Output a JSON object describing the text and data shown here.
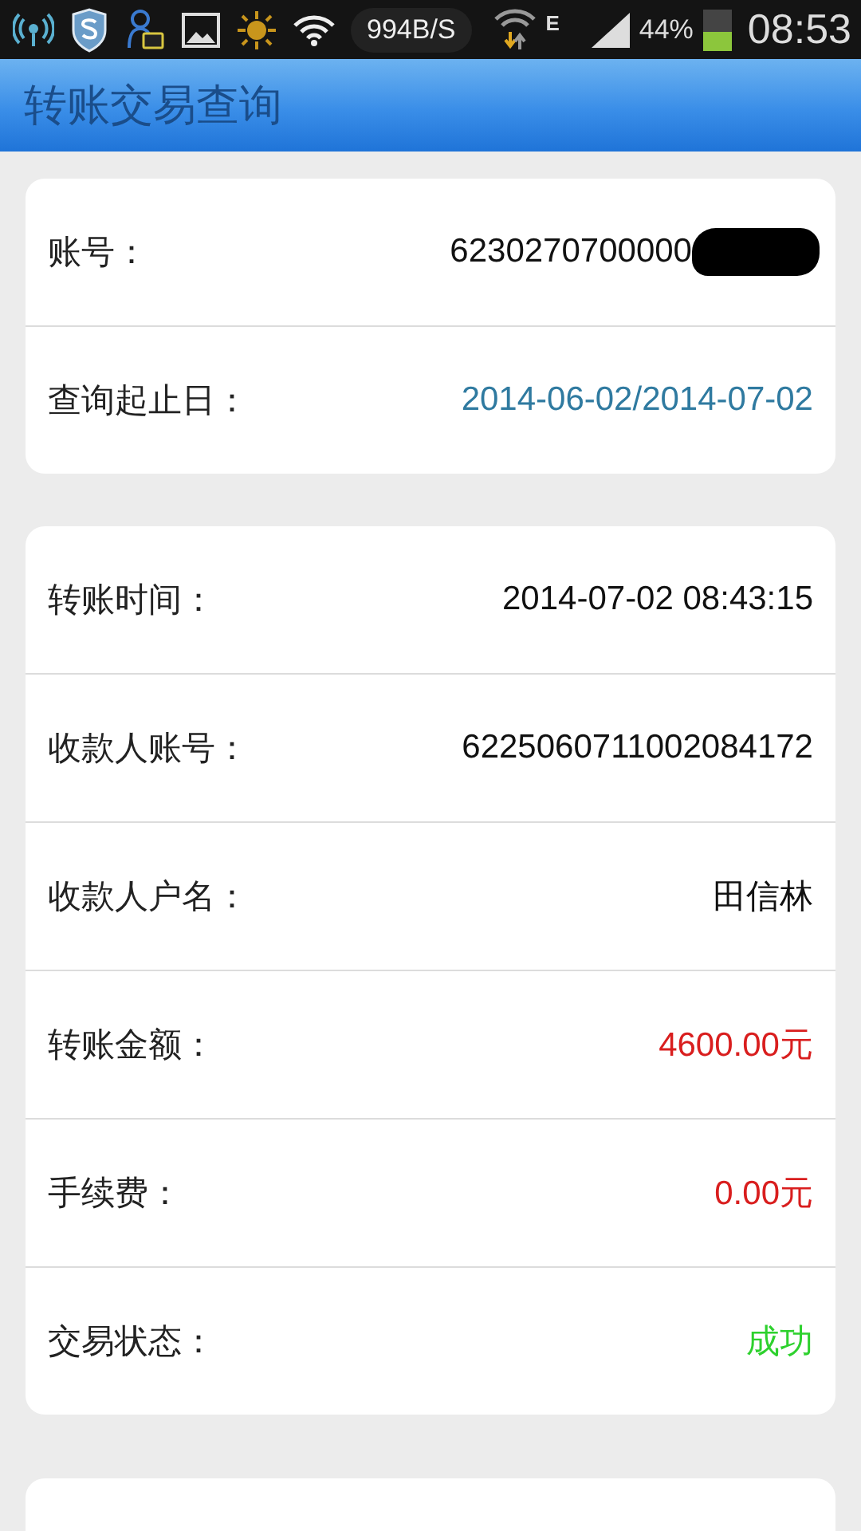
{
  "status_bar": {
    "speed": "994B/S",
    "network": "E",
    "battery": "44%",
    "time": "08:53"
  },
  "header": {
    "title": "转账交易查询"
  },
  "cards": [
    {
      "kind": "full",
      "rows": [
        {
          "label": "账号：",
          "value": "6230270700000",
          "kind": "plain",
          "redacted": true
        },
        {
          "label": "查询起止日：",
          "value": "2014-06-02/2014-07-02",
          "kind": "link",
          "redacted": false
        }
      ]
    },
    {
      "kind": "full",
      "rows": [
        {
          "label": "转账时间：",
          "value": "2014-07-02 08:43:15",
          "kind": "plain",
          "redacted": false
        },
        {
          "label": "收款人账号：",
          "value": "6225060711002084172",
          "kind": "plain",
          "redacted": false
        },
        {
          "label": "收款人户名：",
          "value": "田信林",
          "kind": "plain",
          "redacted": false
        },
        {
          "label": "转账金额：",
          "value": "4600.00元",
          "kind": "amount",
          "redacted": false
        },
        {
          "label": "手续费：",
          "value": "0.00元",
          "kind": "amount",
          "redacted": false
        },
        {
          "label": "交易状态：",
          "value": "成功",
          "kind": "success",
          "redacted": false
        }
      ]
    },
    {
      "kind": "cut-off"
    }
  ]
}
